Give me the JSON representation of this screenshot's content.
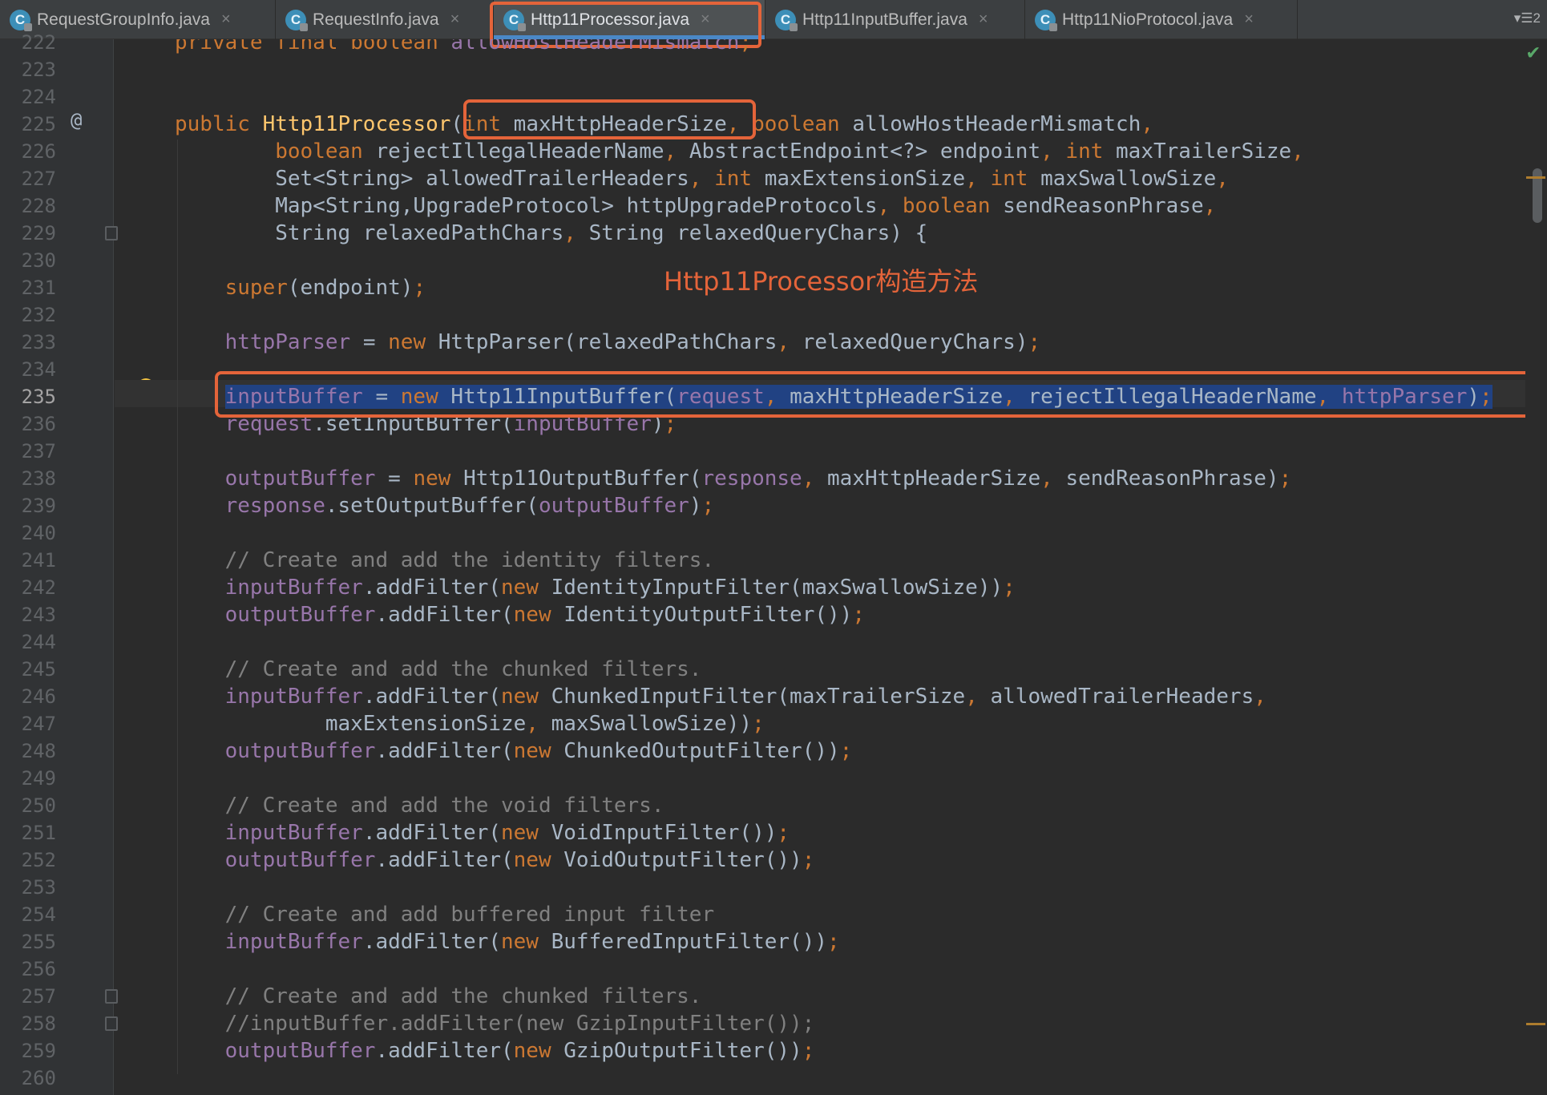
{
  "tabs": [
    {
      "label": "RequestGroupInfo.java",
      "close": "×",
      "icon": "C"
    },
    {
      "label": "RequestInfo.java",
      "close": "×",
      "icon": "C"
    },
    {
      "label": "Http11Processor.java",
      "close": "×",
      "icon": "C",
      "active": true
    },
    {
      "label": "Http11InputBuffer.java",
      "close": "×",
      "icon": "C"
    },
    {
      "label": "Http11NioProtocol.java",
      "close": "×",
      "icon": "C"
    }
  ],
  "tab_menu": "▾☰2",
  "annotation": "Http11Processor构造方法",
  "gutter": {
    "at_marker": "@"
  },
  "colors": {
    "keyword": "#cc7832",
    "method": "#ffc66d",
    "field": "#9876aa",
    "comment": "#808080",
    "annotation": "#e4643a",
    "selection": "#214283"
  },
  "lines": [
    {
      "no": "222",
      "tokens": [
        [
          "kw",
          "private final boolean "
        ],
        [
          "fld",
          "allowHostHeaderMismatch"
        ],
        [
          "kw",
          ";"
        ]
      ]
    },
    {
      "no": "223",
      "tokens": []
    },
    {
      "no": "224",
      "tokens": []
    },
    {
      "no": "225",
      "tokens": [
        [
          "kw",
          "public "
        ],
        [
          "fn",
          "Http11Processor"
        ],
        [
          "",
          "("
        ],
        [
          "kw",
          "int "
        ],
        [
          "",
          "maxHttpHeaderSize"
        ],
        [
          "kw",
          ", boolean "
        ],
        [
          "",
          "allowHostHeaderMismatch"
        ],
        [
          "kw",
          ","
        ]
      ]
    },
    {
      "no": "226",
      "tokens": [
        [
          "",
          "        "
        ],
        [
          "kw",
          "boolean "
        ],
        [
          "",
          "rejectIllegalHeaderName"
        ],
        [
          "kw",
          ", "
        ],
        [
          "",
          "AbstractEndpoint<?> endpoint"
        ],
        [
          "kw",
          ", int "
        ],
        [
          "",
          "maxTrailerSize"
        ],
        [
          "kw",
          ","
        ]
      ]
    },
    {
      "no": "227",
      "tokens": [
        [
          "",
          "        Set<String> allowedTrailerHeaders"
        ],
        [
          "kw",
          ", int "
        ],
        [
          "",
          "maxExtensionSize"
        ],
        [
          "kw",
          ", int "
        ],
        [
          "",
          "maxSwallowSize"
        ],
        [
          "kw",
          ","
        ]
      ]
    },
    {
      "no": "228",
      "tokens": [
        [
          "",
          "        Map<String,UpgradeProtocol> httpUpgradeProtocols"
        ],
        [
          "kw",
          ", boolean "
        ],
        [
          "",
          "sendReasonPhrase"
        ],
        [
          "kw",
          ","
        ]
      ]
    },
    {
      "no": "229",
      "tokens": [
        [
          "",
          "        String relaxedPathChars"
        ],
        [
          "kw",
          ", "
        ],
        [
          "",
          "String relaxedQueryChars) {"
        ]
      ]
    },
    {
      "no": "230",
      "tokens": []
    },
    {
      "no": "231",
      "tokens": [
        [
          "",
          "    "
        ],
        [
          "kw",
          "super"
        ],
        [
          "",
          "(endpoint)"
        ],
        [
          "kw",
          ";"
        ]
      ]
    },
    {
      "no": "232",
      "tokens": []
    },
    {
      "no": "233",
      "tokens": [
        [
          "",
          "    "
        ],
        [
          "fld",
          "httpParser"
        ],
        [
          "",
          " = "
        ],
        [
          "kw",
          "new "
        ],
        [
          "",
          "HttpParser(relaxedPathChars"
        ],
        [
          "kw",
          ", "
        ],
        [
          "",
          "relaxedQueryChars)"
        ],
        [
          "kw",
          ";"
        ]
      ]
    },
    {
      "no": "234",
      "tokens": []
    },
    {
      "no": "235",
      "selected": true,
      "tokens": [
        [
          "",
          "    "
        ],
        [
          "fld sel",
          "inputBuffer"
        ],
        [
          "sel",
          " = "
        ],
        [
          "kw sel",
          "new "
        ],
        [
          "sel",
          "Http11InputBuffer("
        ],
        [
          "fld sel",
          "request"
        ],
        [
          "kw sel",
          ", "
        ],
        [
          "sel",
          "maxHttpHeaderSize"
        ],
        [
          "kw sel",
          ", "
        ],
        [
          "sel",
          "rejectIllegalHeaderName"
        ],
        [
          "kw sel",
          ", "
        ],
        [
          "fld sel",
          "httpParser"
        ],
        [
          "sel",
          ")"
        ],
        [
          "kw sel",
          ";"
        ]
      ]
    },
    {
      "no": "236",
      "tokens": [
        [
          "",
          "    "
        ],
        [
          "fld",
          "request"
        ],
        [
          "",
          ".setInputBuffer("
        ],
        [
          "fld",
          "inputBuffer"
        ],
        [
          "",
          ")"
        ],
        [
          "kw",
          ";"
        ]
      ]
    },
    {
      "no": "237",
      "tokens": []
    },
    {
      "no": "238",
      "tokens": [
        [
          "",
          "    "
        ],
        [
          "fld",
          "outputBuffer"
        ],
        [
          "",
          " = "
        ],
        [
          "kw",
          "new "
        ],
        [
          "",
          "Http11OutputBuffer("
        ],
        [
          "fld",
          "response"
        ],
        [
          "kw",
          ", "
        ],
        [
          "",
          "maxHttpHeaderSize"
        ],
        [
          "kw",
          ", "
        ],
        [
          "",
          "sendReasonPhrase)"
        ],
        [
          "kw",
          ";"
        ]
      ]
    },
    {
      "no": "239",
      "tokens": [
        [
          "",
          "    "
        ],
        [
          "fld",
          "response"
        ],
        [
          "",
          ".setOutputBuffer("
        ],
        [
          "fld",
          "outputBuffer"
        ],
        [
          "",
          ")"
        ],
        [
          "kw",
          ";"
        ]
      ]
    },
    {
      "no": "240",
      "tokens": []
    },
    {
      "no": "241",
      "tokens": [
        [
          "",
          "    "
        ],
        [
          "cm",
          "// Create and add the identity filters."
        ]
      ]
    },
    {
      "no": "242",
      "tokens": [
        [
          "",
          "    "
        ],
        [
          "fld",
          "inputBuffer"
        ],
        [
          "",
          ".addFilter("
        ],
        [
          "kw",
          "new "
        ],
        [
          "",
          "IdentityInputFilter(maxSwallowSize))"
        ],
        [
          "kw",
          ";"
        ]
      ]
    },
    {
      "no": "243",
      "tokens": [
        [
          "",
          "    "
        ],
        [
          "fld",
          "outputBuffer"
        ],
        [
          "",
          ".addFilter("
        ],
        [
          "kw",
          "new "
        ],
        [
          "",
          "IdentityOutputFilter())"
        ],
        [
          "kw",
          ";"
        ]
      ]
    },
    {
      "no": "244",
      "tokens": []
    },
    {
      "no": "245",
      "tokens": [
        [
          "",
          "    "
        ],
        [
          "cm",
          "// Create and add the chunked filters."
        ]
      ]
    },
    {
      "no": "246",
      "tokens": [
        [
          "",
          "    "
        ],
        [
          "fld",
          "inputBuffer"
        ],
        [
          "",
          ".addFilter("
        ],
        [
          "kw",
          "new "
        ],
        [
          "",
          "ChunkedInputFilter(maxTrailerSize"
        ],
        [
          "kw",
          ", "
        ],
        [
          "",
          "allowedTrailerHeaders"
        ],
        [
          "kw",
          ","
        ]
      ]
    },
    {
      "no": "247",
      "tokens": [
        [
          "",
          "            maxExtensionSize"
        ],
        [
          "kw",
          ", "
        ],
        [
          "",
          "maxSwallowSize))"
        ],
        [
          "kw",
          ";"
        ]
      ]
    },
    {
      "no": "248",
      "tokens": [
        [
          "",
          "    "
        ],
        [
          "fld",
          "outputBuffer"
        ],
        [
          "",
          ".addFilter("
        ],
        [
          "kw",
          "new "
        ],
        [
          "",
          "ChunkedOutputFilter())"
        ],
        [
          "kw",
          ";"
        ]
      ]
    },
    {
      "no": "249",
      "tokens": []
    },
    {
      "no": "250",
      "tokens": [
        [
          "",
          "    "
        ],
        [
          "cm",
          "// Create and add the void filters."
        ]
      ]
    },
    {
      "no": "251",
      "tokens": [
        [
          "",
          "    "
        ],
        [
          "fld",
          "inputBuffer"
        ],
        [
          "",
          ".addFilter("
        ],
        [
          "kw",
          "new "
        ],
        [
          "",
          "VoidInputFilter())"
        ],
        [
          "kw",
          ";"
        ]
      ]
    },
    {
      "no": "252",
      "tokens": [
        [
          "",
          "    "
        ],
        [
          "fld",
          "outputBuffer"
        ],
        [
          "",
          ".addFilter("
        ],
        [
          "kw",
          "new "
        ],
        [
          "",
          "VoidOutputFilter())"
        ],
        [
          "kw",
          ";"
        ]
      ]
    },
    {
      "no": "253",
      "tokens": []
    },
    {
      "no": "254",
      "tokens": [
        [
          "",
          "    "
        ],
        [
          "cm",
          "// Create and add buffered input filter"
        ]
      ]
    },
    {
      "no": "255",
      "tokens": [
        [
          "",
          "    "
        ],
        [
          "fld",
          "inputBuffer"
        ],
        [
          "",
          ".addFilter("
        ],
        [
          "kw",
          "new "
        ],
        [
          "",
          "BufferedInputFilter())"
        ],
        [
          "kw",
          ";"
        ]
      ]
    },
    {
      "no": "256",
      "tokens": []
    },
    {
      "no": "257",
      "tokens": [
        [
          "",
          "    "
        ],
        [
          "cm",
          "// Create and add the chunked filters."
        ]
      ]
    },
    {
      "no": "258",
      "tokens": [
        [
          "",
          "    "
        ],
        [
          "cm",
          "//inputBuffer.addFilter(new GzipInputFilter());"
        ]
      ]
    },
    {
      "no": "259",
      "tokens": [
        [
          "",
          "    "
        ],
        [
          "fld",
          "outputBuffer"
        ],
        [
          "",
          ".addFilter("
        ],
        [
          "kw",
          "new "
        ],
        [
          "",
          "GzipOutputFilter())"
        ],
        [
          "kw",
          ";"
        ]
      ]
    },
    {
      "no": "260",
      "tokens": []
    }
  ]
}
